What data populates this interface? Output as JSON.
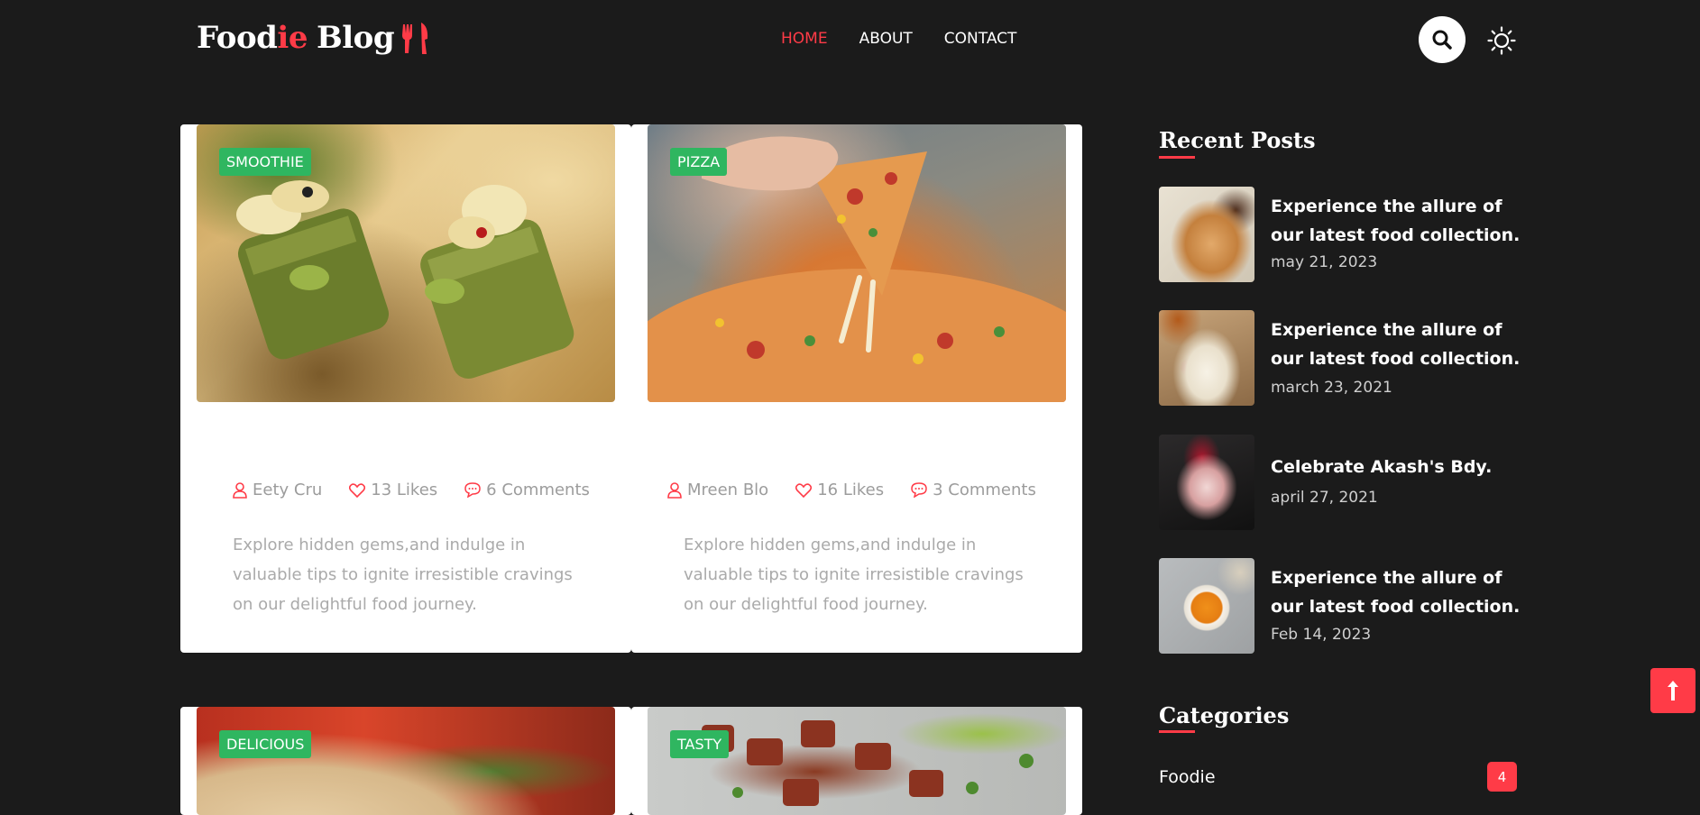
{
  "header": {
    "logo_part1": "Food",
    "logo_accent": "ie",
    "logo_part2": "Blog",
    "nav": [
      "HOME",
      "ABOUT",
      "CONTACT"
    ],
    "active_nav": "HOME"
  },
  "posts": [
    {
      "badge": "SMOOTHIE",
      "author": "Eety Cru",
      "likes": "13 Likes",
      "comments": "6 Comments",
      "excerpt": "Explore hidden gems,and indulge in valuable tips to ignite irresistible cravings on our delightful food journey."
    },
    {
      "badge": "PIZZA",
      "author": "Mreen Blo",
      "likes": "16 Likes",
      "comments": "3 Comments",
      "excerpt": "Explore hidden gems,and indulge in valuable tips to ignite irresistible cravings on our delightful food journey."
    },
    {
      "badge": "DELICIOUS"
    },
    {
      "badge": "TASTY"
    }
  ],
  "sidebar": {
    "recent_title": "Recent Posts",
    "recent": [
      {
        "title": "Experience the allure of our latest food collection.",
        "date": "may 21, 2023"
      },
      {
        "title": "Experience the allure of our latest food collection.",
        "date": "march 23, 2021"
      },
      {
        "title": "Celebrate Akash's Bdy.",
        "date": "april 27, 2021"
      },
      {
        "title": "Experience the allure of our latest food collection.",
        "date": "Feb 14, 2023"
      }
    ],
    "categories_title": "Categories",
    "categories": [
      {
        "name": "Foodie",
        "count": "4"
      }
    ]
  },
  "colors": {
    "accent": "#ff3b47",
    "badge": "#2fb660",
    "background": "#1b1b1b"
  }
}
